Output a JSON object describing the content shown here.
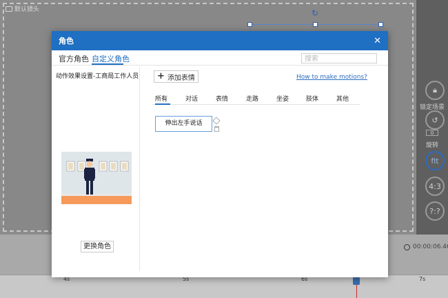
{
  "background": {
    "stage_label": "默认镜头",
    "right_panel": {
      "lock_label": "锁定场景",
      "rotate_label": "旋转",
      "rotate_value": "0",
      "fit_label": "fit",
      "ratio_label": "4:3",
      "unknown_label": "?:?"
    },
    "time_display": "00:00:06.46",
    "ruler_ticks": [
      "4s",
      "5s",
      "6s",
      "7s"
    ]
  },
  "dialog": {
    "title": "角色",
    "tabs": [
      {
        "label": "官方角色",
        "active": false
      },
      {
        "label": "自定义角色",
        "active": true
      }
    ],
    "search_placeholder": "搜索",
    "character_name": "动作效果设置-工商局工作人员",
    "change_character_label": "更换角色",
    "add_expression_label": "添加表情",
    "howto_link": "How to make motions?",
    "categories": [
      {
        "label": "所有",
        "active": true
      },
      {
        "label": "对话",
        "active": false
      },
      {
        "label": "表情",
        "active": false
      },
      {
        "label": "走路",
        "active": false
      },
      {
        "label": "坐姿",
        "active": false
      },
      {
        "label": "肢体",
        "active": false
      },
      {
        "label": "其他",
        "active": false
      }
    ],
    "motions": [
      "伸出左手说话"
    ]
  },
  "colors": {
    "accent": "#1f6fc2",
    "link": "#2b6cc0",
    "floor": "#f59a5a"
  }
}
